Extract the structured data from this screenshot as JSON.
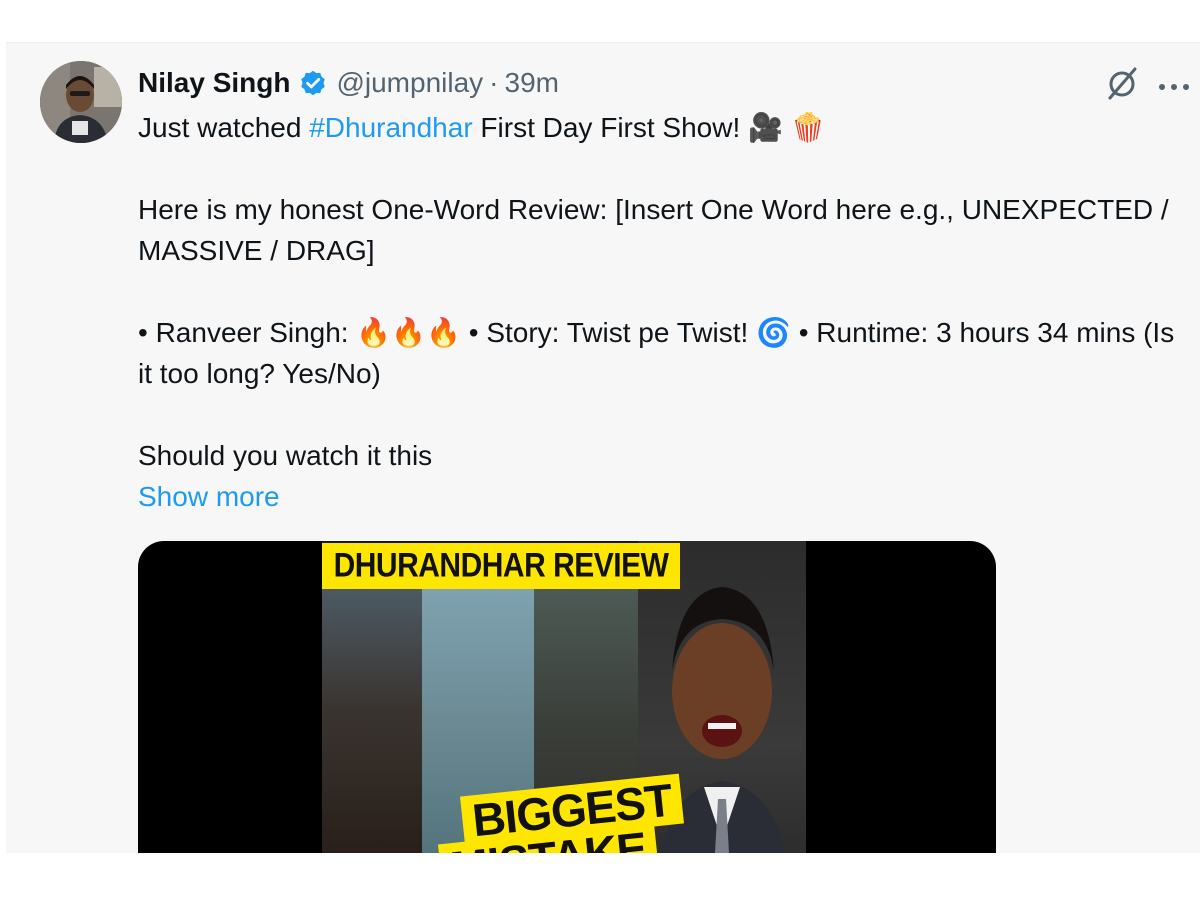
{
  "tweet": {
    "display_name": "Nilay Singh",
    "handle": "@jumpnilay",
    "separator": "·",
    "time": "39m",
    "icons": {
      "verified": "verified-badge-icon",
      "grok": "grok-icon",
      "more": "more-icon"
    },
    "text": {
      "line1_prefix": "Just watched ",
      "hashtag": "#Dhurandhar",
      "line1_suffix": " First Day First Show! ",
      "line1_emoji_camera": "🎥",
      "line1_emoji_popcorn": "🍿",
      "para2": "Here is my honest One-Word Review: [Insert One Word here e.g., UNEXPECTED / MASSIVE / DRAG]",
      "para3_a": "• Ranveer Singh: ",
      "para3_fire": "🔥🔥🔥",
      "para3_b": " • Story: Twist pe Twist! ",
      "para3_cyclone": "🌀",
      "para3_c": " • Runtime: 3 hours 34 mins (Is it too long? Yes/No)",
      "para4": "Should you watch it this",
      "show_more": "Show more"
    },
    "media": {
      "thumbnail_title": "DHURANDHAR REVIEW",
      "thumbnail_text_1": "BIGGEST",
      "thumbnail_text_2": "MISTAKE"
    }
  },
  "colors": {
    "link": "#1d9bf0",
    "text": "#0f1419",
    "muted": "#536471",
    "card_bg": "#f7f7f7",
    "thumb_yellow": "#ffe600"
  }
}
